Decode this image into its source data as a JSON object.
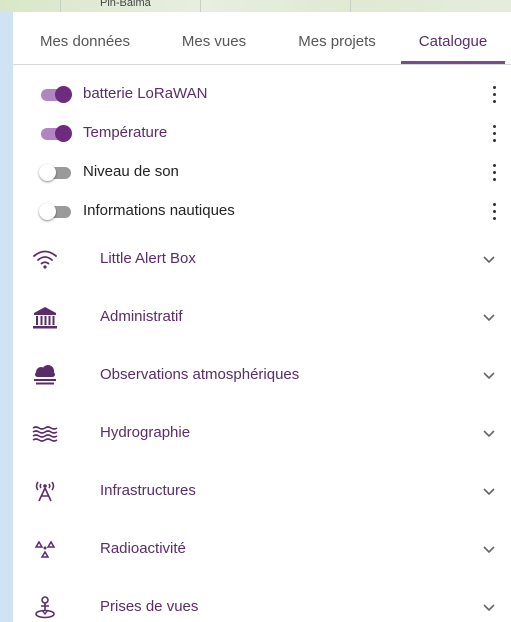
{
  "map": {
    "place_label": "Pin-Balma"
  },
  "tabs": [
    {
      "label": "Mes données",
      "active": false
    },
    {
      "label": "Mes vues",
      "active": false
    },
    {
      "label": "Mes projets",
      "active": false
    },
    {
      "label": "Catalogue",
      "active": true
    }
  ],
  "layers": [
    {
      "label": "batterie LoRaWAN",
      "enabled": true
    },
    {
      "label": "Température",
      "enabled": true
    },
    {
      "label": "Niveau de son",
      "enabled": false
    },
    {
      "label": "Informations nautiques",
      "enabled": false
    }
  ],
  "categories": [
    {
      "label": "Little Alert Box",
      "icon": "wifi-icon"
    },
    {
      "label": "Administratif",
      "icon": "building-icon"
    },
    {
      "label": "Observations atmosphériques",
      "icon": "cloud-sun-icon"
    },
    {
      "label": "Hydrographie",
      "icon": "water-waves-icon"
    },
    {
      "label": "Infrastructures",
      "icon": "antenna-icon"
    },
    {
      "label": "Radioactivité",
      "icon": "radioactive-icon"
    },
    {
      "label": "Prises de vues",
      "icon": "camera-person-icon"
    }
  ],
  "colors": {
    "accent": "#5a2c6a",
    "toggle_on_track": "#b184c2",
    "toggle_on_knob": "#6d2c80",
    "background": "#cfe3f3"
  }
}
